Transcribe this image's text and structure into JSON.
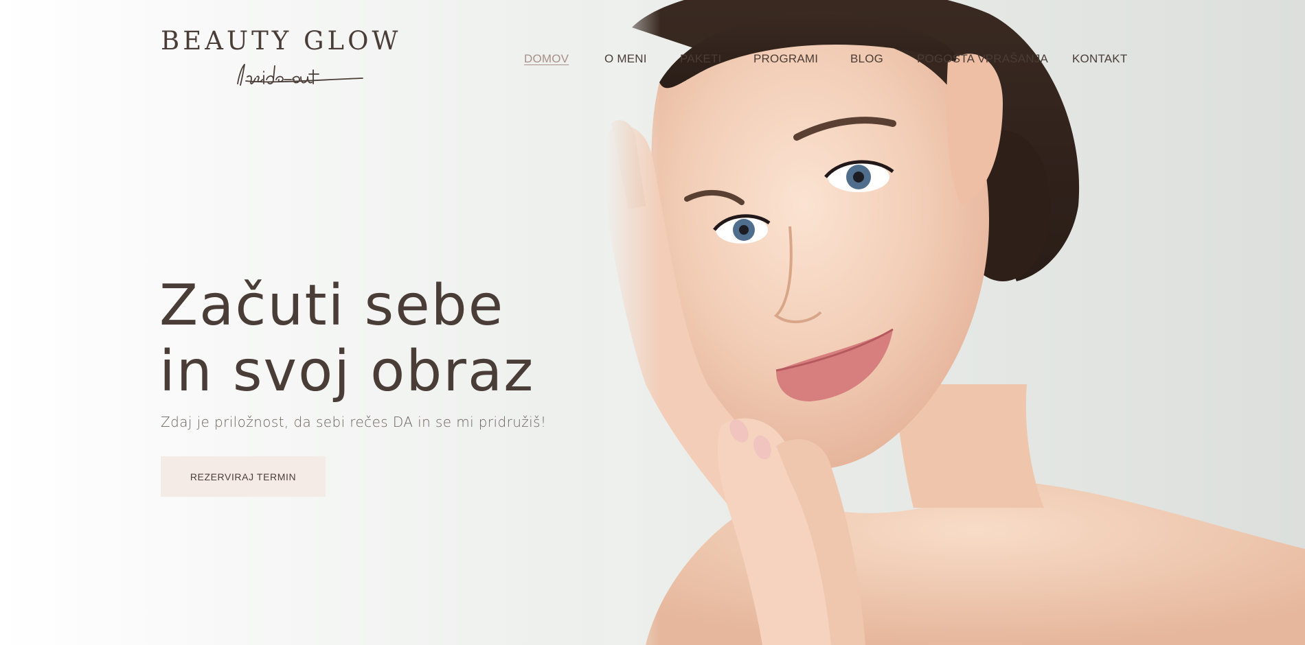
{
  "brand": {
    "name": "BEAUTY GLOW",
    "tagline": "Inside-out"
  },
  "nav": {
    "items": [
      {
        "label": "DOMOV",
        "active": true
      },
      {
        "label": "O MENI",
        "active": false
      },
      {
        "label": "PAKETI",
        "active": false
      },
      {
        "label": "PROGRAMI",
        "active": false
      },
      {
        "label": "BLOG",
        "active": false
      },
      {
        "label": "POGOSTA VPRAŠANJA",
        "active": false
      },
      {
        "label": "KONTAKT",
        "active": false
      }
    ]
  },
  "hero": {
    "headline_line1": "Začuti sebe",
    "headline_line2": "in svoj obraz",
    "subtitle": "Zdaj je priložnost, da sebi rečes DA in se mi pridružiš!",
    "cta_label": "REZERVIRAJ TERMIN"
  },
  "colors": {
    "text_dark": "#4a3c36",
    "nav_active": "#a88f87",
    "cta_bg": "#f5ebe6",
    "background": "#eef0ee"
  },
  "icons": {
    "logo_script": "inside-out-script-logo"
  }
}
